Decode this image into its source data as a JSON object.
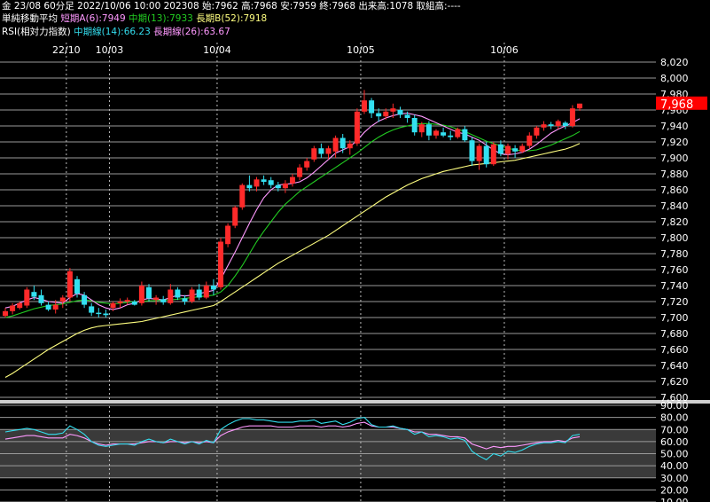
{
  "header": {
    "line1": "金 23/08 60分足 2022/10/06 10:00 202308 始:7962 高:7968 安:7959 終:7968 出来高:1078 取組高:----",
    "ma_title": "単純移動平均",
    "ma_short": "短期A(6):7949",
    "ma_mid": "中期(13):7933",
    "ma_long": "長期B(52):7918",
    "rsi_title": "RSI(相対力指数)",
    "rsi_mid": "中期線(14):66.23",
    "rsi_long": "長期線(26):63.67"
  },
  "colors": {
    "up": "#ff2a2a",
    "down": "#33e0f0",
    "ma_short": "#ff99ff",
    "ma_mid": "#22cc22",
    "ma_long": "#ffff80",
    "rsi_mid": "#33ddee",
    "rsi_long": "#ff99ff",
    "price_tag_bg": "#ff0000"
  },
  "chart_data": [
    {
      "type": "candlestick",
      "title": "金 23/08 60分足",
      "date_labels": [
        {
          "label": "22/10",
          "index": 9
        },
        {
          "label": "10/03",
          "index": 15
        },
        {
          "label": "10/04",
          "index": 30
        },
        {
          "label": "10/05",
          "index": 50
        },
        {
          "label": "10/06",
          "index": 70
        }
      ],
      "last_price": "7,968",
      "ylim": [
        7600,
        8020
      ],
      "y_ticks": [
        "7,600",
        "7,620",
        "7,640",
        "7,660",
        "7,680",
        "7,700",
        "7,720",
        "7,740",
        "7,760",
        "7,780",
        "7,800",
        "7,820",
        "7,840",
        "7,860",
        "7,880",
        "7,900",
        "7,920",
        "7,940",
        "7,960",
        "7,980",
        "8,000",
        "8,020"
      ],
      "candles": [
        [
          7702,
          7712,
          7700,
          7708
        ],
        [
          7708,
          7718,
          7704,
          7715
        ],
        [
          7712,
          7720,
          7710,
          7718
        ],
        [
          7715,
          7738,
          7712,
          7735
        ],
        [
          7732,
          7740,
          7722,
          7726
        ],
        [
          7728,
          7735,
          7715,
          7718
        ],
        [
          7716,
          7720,
          7708,
          7710
        ],
        [
          7710,
          7722,
          7705,
          7716
        ],
        [
          7720,
          7728,
          7712,
          7725
        ],
        [
          7725,
          7762,
          7720,
          7758
        ],
        [
          7748,
          7752,
          7725,
          7730
        ],
        [
          7728,
          7732,
          7712,
          7716
        ],
        [
          7714,
          7718,
          7702,
          7706
        ],
        [
          7706,
          7712,
          7700,
          7705
        ],
        [
          7705,
          7710,
          7700,
          7703
        ],
        [
          7712,
          7720,
          7708,
          7718
        ],
        [
          7718,
          7724,
          7712,
          7720
        ],
        [
          7720,
          7725,
          7716,
          7722
        ],
        [
          7720,
          7722,
          7715,
          7716
        ],
        [
          7718,
          7745,
          7715,
          7740
        ],
        [
          7738,
          7742,
          7720,
          7724
        ],
        [
          7722,
          7728,
          7716,
          7725
        ],
        [
          7723,
          7727,
          7716,
          7719
        ],
        [
          7718,
          7742,
          7716,
          7735
        ],
        [
          7735,
          7738,
          7722,
          7725
        ],
        [
          7724,
          7728,
          7716,
          7720
        ],
        [
          7720,
          7738,
          7718,
          7735
        ],
        [
          7735,
          7742,
          7722,
          7725
        ],
        [
          7725,
          7745,
          7723,
          7740
        ],
        [
          7740,
          7748,
          7728,
          7735
        ],
        [
          7738,
          7800,
          7735,
          7795
        ],
        [
          7792,
          7818,
          7788,
          7815
        ],
        [
          7815,
          7840,
          7812,
          7838
        ],
        [
          7838,
          7868,
          7835,
          7866
        ],
        [
          7866,
          7878,
          7858,
          7862
        ],
        [
          7864,
          7876,
          7858,
          7873
        ],
        [
          7873,
          7878,
          7866,
          7870
        ],
        [
          7872,
          7876,
          7862,
          7866
        ],
        [
          7866,
          7870,
          7858,
          7862
        ],
        [
          7862,
          7872,
          7856,
          7868
        ],
        [
          7868,
          7880,
          7864,
          7876
        ],
        [
          7876,
          7892,
          7872,
          7888
        ],
        [
          7888,
          7900,
          7884,
          7896
        ],
        [
          7898,
          7915,
          7895,
          7912
        ],
        [
          7912,
          7918,
          7900,
          7905
        ],
        [
          7905,
          7915,
          7898,
          7912
        ],
        [
          7908,
          7928,
          7900,
          7925
        ],
        [
          7925,
          7930,
          7906,
          7912
        ],
        [
          7912,
          7922,
          7904,
          7918
        ],
        [
          7918,
          7962,
          7915,
          7958
        ],
        [
          7958,
          7985,
          7955,
          7972
        ],
        [
          7972,
          7975,
          7950,
          7956
        ],
        [
          7956,
          7962,
          7945,
          7952
        ],
        [
          7952,
          7962,
          7948,
          7958
        ],
        [
          7958,
          7968,
          7950,
          7962
        ],
        [
          7960,
          7964,
          7950,
          7954
        ],
        [
          7954,
          7958,
          7944,
          7950
        ],
        [
          7950,
          7954,
          7928,
          7932
        ],
        [
          7932,
          7945,
          7926,
          7942
        ],
        [
          7942,
          7946,
          7922,
          7928
        ],
        [
          7928,
          7936,
          7924,
          7934
        ],
        [
          7932,
          7938,
          7926,
          7928
        ],
        [
          7928,
          7934,
          7922,
          7926
        ],
        [
          7926,
          7938,
          7924,
          7936
        ],
        [
          7936,
          7940,
          7920,
          7922
        ],
        [
          7922,
          7926,
          7890,
          7896
        ],
        [
          7896,
          7918,
          7885,
          7915
        ],
        [
          7915,
          7920,
          7888,
          7892
        ],
        [
          7892,
          7920,
          7890,
          7917
        ],
        [
          7917,
          7922,
          7902,
          7905
        ],
        [
          7905,
          7918,
          7898,
          7915
        ],
        [
          7912,
          7916,
          7900,
          7908
        ],
        [
          7908,
          7918,
          7906,
          7915
        ],
        [
          7915,
          7932,
          7912,
          7928
        ],
        [
          7928,
          7940,
          7924,
          7938
        ],
        [
          7938,
          7946,
          7934,
          7942
        ],
        [
          7942,
          7945,
          7936,
          7940
        ],
        [
          7940,
          7948,
          7936,
          7946
        ],
        [
          7944,
          7946,
          7936,
          7940
        ],
        [
          7940,
          7966,
          7938,
          7962
        ],
        [
          7962,
          7968,
          7959,
          7968
        ]
      ],
      "ma_short": [
        7712,
        7714,
        7718,
        7722,
        7725,
        7723,
        7720,
        7719,
        7718,
        7725,
        7730,
        7728,
        7722,
        7716,
        7712,
        7710,
        7712,
        7716,
        7718,
        7722,
        7724,
        7723,
        7722,
        7725,
        7728,
        7727,
        7728,
        7730,
        7732,
        7734,
        7748,
        7765,
        7782,
        7800,
        7818,
        7835,
        7850,
        7860,
        7866,
        7867,
        7868,
        7870,
        7875,
        7882,
        7890,
        7898,
        7906,
        7910,
        7914,
        7922,
        7932,
        7940,
        7946,
        7950,
        7953,
        7955,
        7956,
        7954,
        7952,
        7948,
        7944,
        7940,
        7936,
        7932,
        7930,
        7926,
        7922,
        7916,
        7910,
        7905,
        7904,
        7905,
        7907,
        7911,
        7917,
        7924,
        7931,
        7936,
        7940,
        7944,
        7949
      ],
      "ma_mid": [
        7700,
        7702,
        7705,
        7708,
        7711,
        7713,
        7715,
        7716,
        7717,
        7719,
        7721,
        7722,
        7721,
        7719,
        7718,
        7717,
        7718,
        7719,
        7720,
        7720,
        7721,
        7721,
        7722,
        7722,
        7723,
        7724,
        7725,
        7726,
        7727,
        7728,
        7732,
        7740,
        7752,
        7765,
        7780,
        7795,
        7808,
        7820,
        7832,
        7842,
        7850,
        7858,
        7864,
        7870,
        7876,
        7882,
        7888,
        7894,
        7900,
        7906,
        7913,
        7920,
        7926,
        7931,
        7935,
        7938,
        7940,
        7942,
        7943,
        7943,
        7942,
        7941,
        7939,
        7936,
        7933,
        7929,
        7925,
        7921,
        7918,
        7915,
        7912,
        7910,
        7909,
        7909,
        7910,
        7913,
        7916,
        7920,
        7924,
        7928,
        7933
      ],
      "ma_long": [
        7625,
        7630,
        7636,
        7642,
        7648,
        7654,
        7660,
        7665,
        7670,
        7675,
        7680,
        7684,
        7687,
        7689,
        7690,
        7691,
        7692,
        7693,
        7694,
        7695,
        7697,
        7699,
        7701,
        7703,
        7705,
        7707,
        7709,
        7711,
        7713,
        7715,
        7720,
        7726,
        7732,
        7738,
        7744,
        7750,
        7756,
        7762,
        7768,
        7773,
        7778,
        7783,
        7788,
        7793,
        7798,
        7803,
        7809,
        7815,
        7821,
        7827,
        7833,
        7839,
        7845,
        7851,
        7856,
        7861,
        7866,
        7870,
        7874,
        7877,
        7880,
        7883,
        7885,
        7887,
        7889,
        7891,
        7892,
        7893,
        7894,
        7895,
        7896,
        7897,
        7899,
        7901,
        7903,
        7905,
        7907,
        7909,
        7911,
        7914,
        7918
      ]
    },
    {
      "type": "line",
      "title": "RSI(相対力指数)",
      "ylim": [
        10,
        90
      ],
      "y_ticks": [
        "10.00",
        "20.00",
        "30.00",
        "40.00",
        "50.00",
        "60.00",
        "70.00",
        "80.00",
        "90.00"
      ],
      "series": [
        {
          "name": "中期線(14)",
          "values": [
            68,
            69,
            70,
            71,
            70,
            68,
            66,
            66,
            67,
            73,
            70,
            66,
            60,
            57,
            56,
            57,
            58,
            58,
            57,
            60,
            62,
            60,
            59,
            62,
            60,
            58,
            60,
            58,
            61,
            59,
            70,
            74,
            77,
            79,
            79,
            78,
            78,
            77,
            76,
            76,
            76,
            77,
            77,
            78,
            75,
            76,
            77,
            74,
            76,
            79,
            80,
            74,
            72,
            72,
            73,
            71,
            70,
            66,
            68,
            64,
            65,
            64,
            62,
            63,
            61,
            52,
            48,
            45,
            50,
            48,
            52,
            51,
            53,
            56,
            58,
            59,
            59,
            60,
            59,
            65,
            66
          ]
        },
        {
          "name": "長期線(26)",
          "values": [
            62,
            63,
            64,
            65,
            65,
            64,
            63,
            63,
            63,
            66,
            65,
            63,
            60,
            58,
            57,
            58,
            58,
            58,
            58,
            59,
            60,
            60,
            59,
            60,
            60,
            59,
            60,
            59,
            60,
            59,
            65,
            68,
            70,
            72,
            73,
            73,
            73,
            73,
            72,
            72,
            72,
            73,
            73,
            73,
            72,
            73,
            73,
            72,
            73,
            75,
            76,
            73,
            72,
            72,
            72,
            71,
            70,
            68,
            68,
            66,
            66,
            65,
            64,
            64,
            63,
            58,
            56,
            54,
            56,
            55,
            56,
            56,
            57,
            58,
            59,
            60,
            60,
            61,
            60,
            63,
            64
          ]
        }
      ]
    }
  ]
}
